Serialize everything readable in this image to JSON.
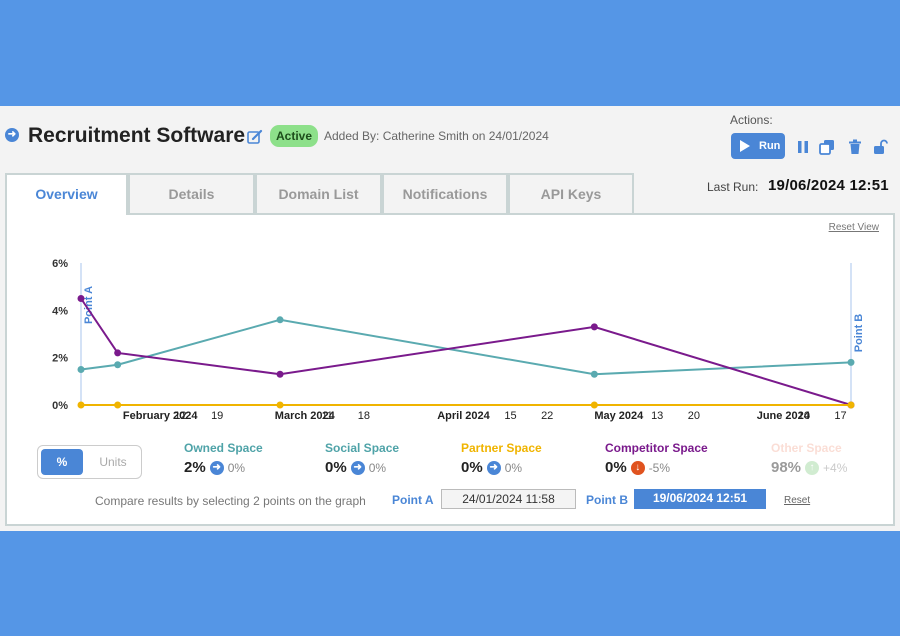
{
  "header": {
    "title": "Recruitment Software",
    "status": "Active",
    "added_by": "Added By: Catherine Smith on 24/01/2024",
    "actions_label": "Actions:",
    "run_label": "Run",
    "last_run_label": "Last Run:",
    "last_run_value": "19/06/2024 12:51"
  },
  "tabs": [
    {
      "label": "Overview"
    },
    {
      "label": "Details"
    },
    {
      "label": "Domain List"
    },
    {
      "label": "Notifications"
    },
    {
      "label": "API Keys"
    }
  ],
  "reset_view": "Reset View",
  "chart_data": {
    "type": "line",
    "x_tick_labels": [
      "February 2024",
      "12",
      "19",
      "March 2024",
      "11",
      "18",
      "April 2024",
      "15",
      "22",
      "May 2024",
      "13",
      "20",
      "June 2024",
      "10",
      "17"
    ],
    "y_tick_labels": [
      "0%",
      "2%",
      "4%",
      "6%"
    ],
    "ylim": [
      0,
      6
    ],
    "x": [
      "2024-01-24",
      "2024-01-31",
      "2024-03-02",
      "2024-05-01",
      "2024-06-19"
    ],
    "series": [
      {
        "name": "Owned Space",
        "color": "#5aaab0",
        "values": [
          1.5,
          1.7,
          3.6,
          1.3,
          1.8
        ]
      },
      {
        "name": "Competitor Space",
        "color": "#7a1a8c",
        "values": [
          4.5,
          2.2,
          1.3,
          3.3,
          0
        ]
      },
      {
        "name": "Partner Space",
        "color": "#f0b400",
        "values": [
          0,
          0,
          0,
          0,
          0
        ]
      }
    ],
    "point_a_label": "Point A",
    "point_b_label": "Point B"
  },
  "toggle": {
    "percent": "%",
    "units": "Units"
  },
  "metrics": [
    {
      "name": "Owned Space",
      "value": "2%",
      "change": "0%",
      "color": "#4fa3a8",
      "icon": "arrow-right-icon",
      "icon_color": "#4a86d6"
    },
    {
      "name": "Social Space",
      "value": "0%",
      "change": "0%",
      "color": "#4fa3a8",
      "icon": "arrow-right-icon",
      "icon_color": "#4a86d6"
    },
    {
      "name": "Partner Space",
      "value": "0%",
      "change": "0%",
      "color": "#f0b400",
      "icon": "arrow-right-icon",
      "icon_color": "#4a86d6"
    },
    {
      "name": "Competitor Space",
      "value": "0%",
      "change": "-5%",
      "color": "#7a1a8c",
      "icon": "arrow-down-icon",
      "icon_color": "#e0531f"
    },
    {
      "name": "Other Space",
      "value": "98%",
      "change": "+4%",
      "color": "#f6b6a4",
      "icon": "arrow-up-icon",
      "icon_color": "#9ad69a"
    }
  ],
  "compare": {
    "text": "Compare results by selecting 2 points on the graph",
    "point_a_label": "Point A",
    "point_a_value": "24/01/2024 11:58",
    "point_b_label": "Point B",
    "point_b_value": "19/06/2024 12:51",
    "reset": "Reset"
  }
}
